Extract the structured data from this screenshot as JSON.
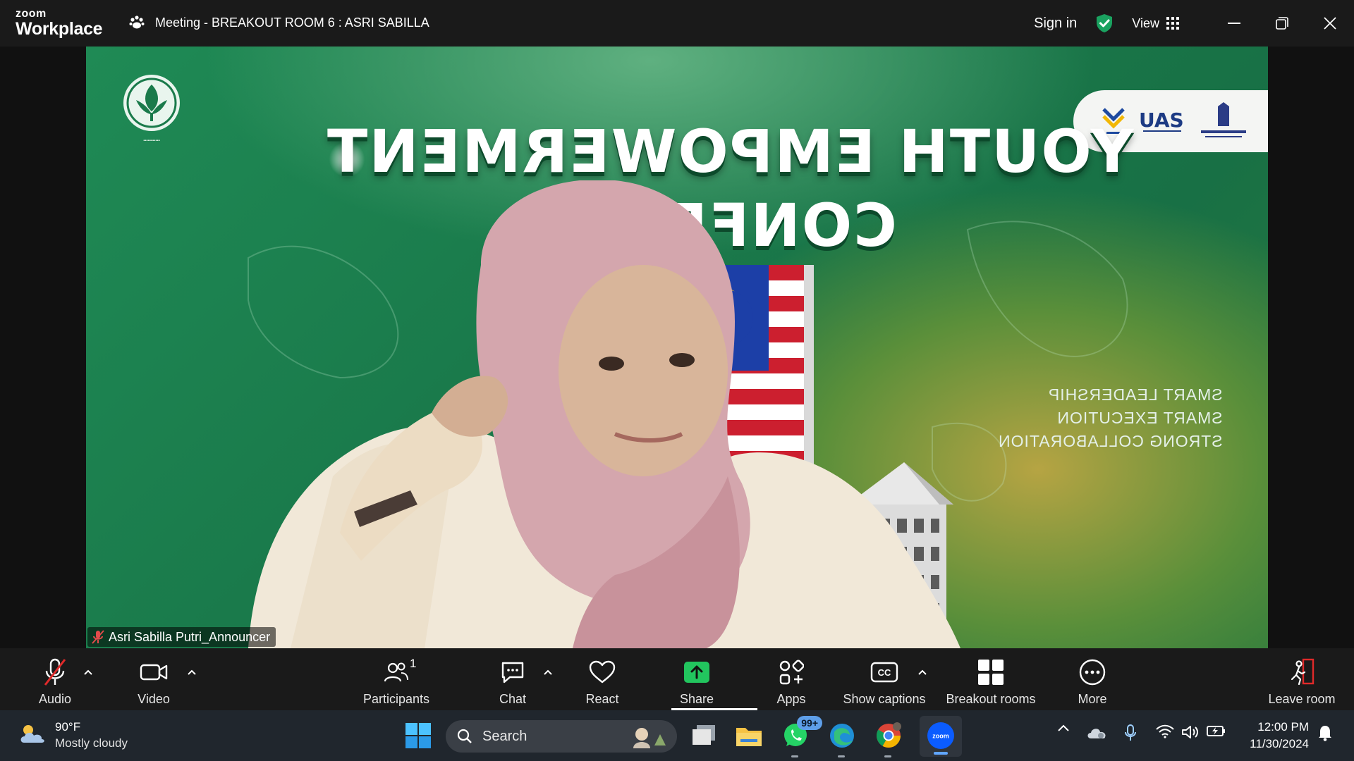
{
  "titlebar": {
    "brand_top": "zoom",
    "brand_bottom": "Workplace",
    "meeting_title": "Meeting - BREAKOUT ROOM 6 : ASRI SABILLA",
    "sign_in": "Sign in",
    "view_label": "View"
  },
  "video": {
    "headline_line1": "YOUTH EMPOWERMENT",
    "headline_line2": "CONFER",
    "tagline": [
      "SMART LEADERSHIP",
      "SMART EXECUTION",
      "STRONG COLLABORATION"
    ],
    "participant_name": "Asri Sabilla Putri_Announcer"
  },
  "toolbar": {
    "audio": "Audio",
    "video": "Video",
    "participants": "Participants",
    "participants_count": "1",
    "chat": "Chat",
    "react": "React",
    "share": "Share",
    "apps": "Apps",
    "captions": "Show captions",
    "breakout": "Breakout rooms",
    "more": "More",
    "leave": "Leave room"
  },
  "taskbar": {
    "temperature": "90°F",
    "weather": "Mostly cloudy",
    "search_placeholder": "Search",
    "whatsapp_badge": "99+",
    "zoom_label": "zoom",
    "time": "12:00 PM",
    "date": "11/30/2024"
  },
  "colors": {
    "accent_green": "#1aa260",
    "share_green": "#22c55e",
    "leave_red": "#e02a2a"
  }
}
